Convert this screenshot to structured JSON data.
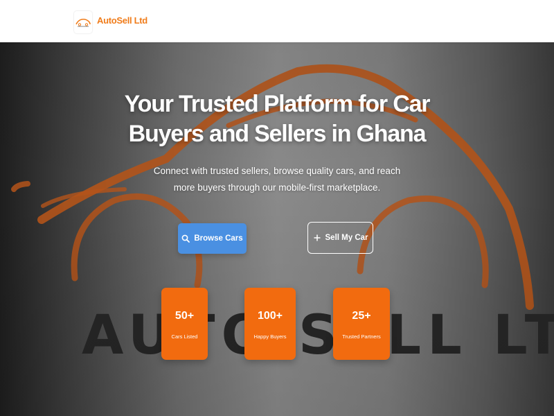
{
  "header": {
    "brand": "AutoSell Ltd",
    "logo_icon": "car-logo-icon"
  },
  "hero": {
    "title_line1": "Your Trusted Platform for Car",
    "title_line2": "Buyers and Sellers in Ghana",
    "subtitle_line1": "Connect with trusted sellers, browse quality cars, and reach",
    "subtitle_line2": "more buyers through our mobile-first marketplace.",
    "background_wordmark": "AUTO SELL LTD",
    "buttons": {
      "browse": {
        "label": "Browse Cars",
        "icon": "search-icon"
      },
      "sell": {
        "label": "Sell My Car",
        "icon": "plus-icon"
      }
    },
    "stats": [
      {
        "value": "50+",
        "label": "Cars Listed"
      },
      {
        "value": "100+",
        "label": "Happy Buyers"
      },
      {
        "value": "25+",
        "label": "Trusted Partners"
      }
    ]
  },
  "colors": {
    "brand_orange": "#f26b0f",
    "primary_blue": "#4a90e2",
    "header_bg": "#ffffff"
  }
}
